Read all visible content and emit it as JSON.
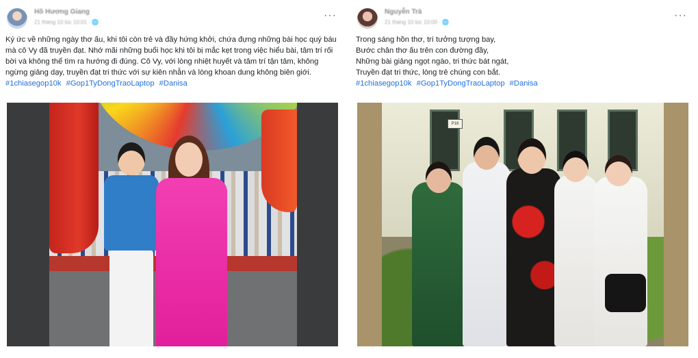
{
  "posts": [
    {
      "author": "Hồ Hương Giang",
      "meta": "21 tháng 10 lúc 10:01 · 🌐",
      "more_label": "···",
      "text_lines": [
        "Ký ức về những ngày thơ ấu, khi tôi còn trẻ và đầy hứng khởi, chứa đựng những bài học quý báu",
        "mà cô Vy đã truyền đạt. Nhớ mãi những buổi học khi tôi bị mắc kẹt trong việc hiểu bài, tâm trí rối",
        "bời và không thể tìm ra hướng đi đúng. Cô Vy, với lòng nhiệt huyết và tâm trí tận tâm, không",
        "ngừng giảng dạy, truyền đạt tri thức với sự kiên nhẫn và lòng khoan dung không biên giới."
      ],
      "hashtags": [
        "#1chiasegop10k",
        "#Gop1TyDongTraoLaptop",
        "#Danisa"
      ]
    },
    {
      "author": "Nguyễn Trà",
      "meta": "21 tháng 10 lúc 10:00 · 🌐",
      "more_label": "···",
      "text_lines": [
        "Trong sáng hồn thơ, trí tưởng tượng bay,",
        "Bước chân thơ ấu trên con đường đầy,",
        "Những bài giảng ngọt ngào, tri thức bát ngát,",
        "Truyền đạt tri thức, lòng trẻ chúng con bắt."
      ],
      "hashtags": [
        "#1chiasegop10k",
        "#Gop1TyDongTraoLaptop",
        "#Danisa"
      ],
      "photo_door_label": "P18"
    }
  ],
  "colors": {
    "hashtag": "#216fdb",
    "text": "#1c1e21"
  }
}
